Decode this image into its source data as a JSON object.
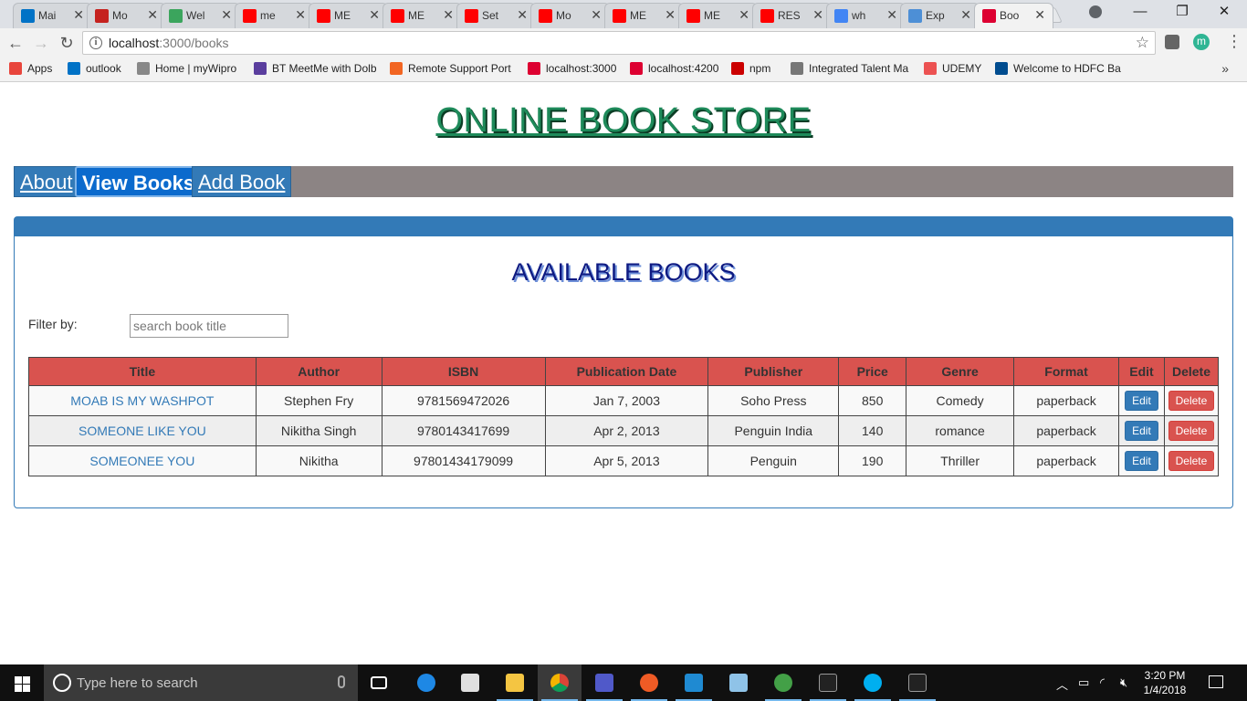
{
  "browser": {
    "tabs": [
      {
        "title": "Mai",
        "color": "#0072c6"
      },
      {
        "title": "Mo",
        "color": "#c5221f"
      },
      {
        "title": "Wel",
        "color": "#3ba55d"
      },
      {
        "title": "me",
        "color": "#ff0000"
      },
      {
        "title": "ME",
        "color": "#ff0000"
      },
      {
        "title": "ME",
        "color": "#ff0000"
      },
      {
        "title": "Set",
        "color": "#ff0000"
      },
      {
        "title": "Mo",
        "color": "#ff0000"
      },
      {
        "title": "ME",
        "color": "#ff0000"
      },
      {
        "title": "ME",
        "color": "#ff0000"
      },
      {
        "title": "RES",
        "color": "#ff0000"
      },
      {
        "title": "wh",
        "color": "#4285f4"
      },
      {
        "title": "Exp",
        "color": "#4d8fd6"
      },
      {
        "title": "Boo",
        "color": "#dd0031"
      }
    ],
    "tab_close": "✕",
    "url_host": "localhost",
    "url_path": ":3000/books",
    "bookmarks": [
      {
        "label": "Apps",
        "color": "#e8453c"
      },
      {
        "label": "outlook",
        "color": "#0072c6"
      },
      {
        "label": "Home | myWipro",
        "color": "#888888"
      },
      {
        "label": "BT MeetMe with Dolb",
        "color": "#5a3e9e"
      },
      {
        "label": "Remote Support Port",
        "color": "#f26522"
      },
      {
        "label": "localhost:3000",
        "color": "#dd0031"
      },
      {
        "label": "localhost:4200",
        "color": "#dd0031"
      },
      {
        "label": "npm",
        "color": "#cb0000"
      },
      {
        "label": "Integrated Talent Ma",
        "color": "#777777"
      },
      {
        "label": "UDEMY",
        "color": "#ec5252"
      },
      {
        "label": "Welcome to HDFC Ba",
        "color": "#004c8f"
      }
    ],
    "profile_initial": "m"
  },
  "page": {
    "store_title": "ONLINE BOOK STORE",
    "nav": [
      {
        "label": "About",
        "active": false
      },
      {
        "label": "View Books",
        "active": true
      },
      {
        "label": "Add Book",
        "active": false
      }
    ],
    "books_heading": "AVAILABLE BOOKS",
    "filter": {
      "label": "Filter by:",
      "placeholder": "search book title",
      "value": ""
    },
    "table": {
      "columns": [
        "Title",
        "Author",
        "ISBN",
        "Publication Date",
        "Publisher",
        "Price",
        "Genre",
        "Format",
        "Edit",
        "Delete"
      ],
      "rows": [
        {
          "title": "MOAB IS MY WASHPOT",
          "author": "Stephen Fry",
          "isbn": "9781569472026",
          "date": "Jan 7, 2003",
          "publisher": "Soho Press",
          "price": "850",
          "genre": "Comedy",
          "format": "paperback"
        },
        {
          "title": "SOMEONE LIKE YOU",
          "author": "Nikitha Singh",
          "isbn": "9780143417699",
          "date": "Apr 2, 2013",
          "publisher": "Penguin India",
          "price": "140",
          "genre": "romance",
          "format": "paperback"
        },
        {
          "title": "SOMEONEE YOU",
          "author": "Nikitha",
          "isbn": "97801434179099",
          "date": "Apr 5, 2013",
          "publisher": "Penguin",
          "price": "190",
          "genre": "Thriller",
          "format": "paperback"
        }
      ],
      "edit_label": "Edit",
      "delete_label": "Delete"
    }
  },
  "taskbar": {
    "search_placeholder": "Type here to search",
    "time": "3:20 PM",
    "date": "1/4/2018"
  }
}
